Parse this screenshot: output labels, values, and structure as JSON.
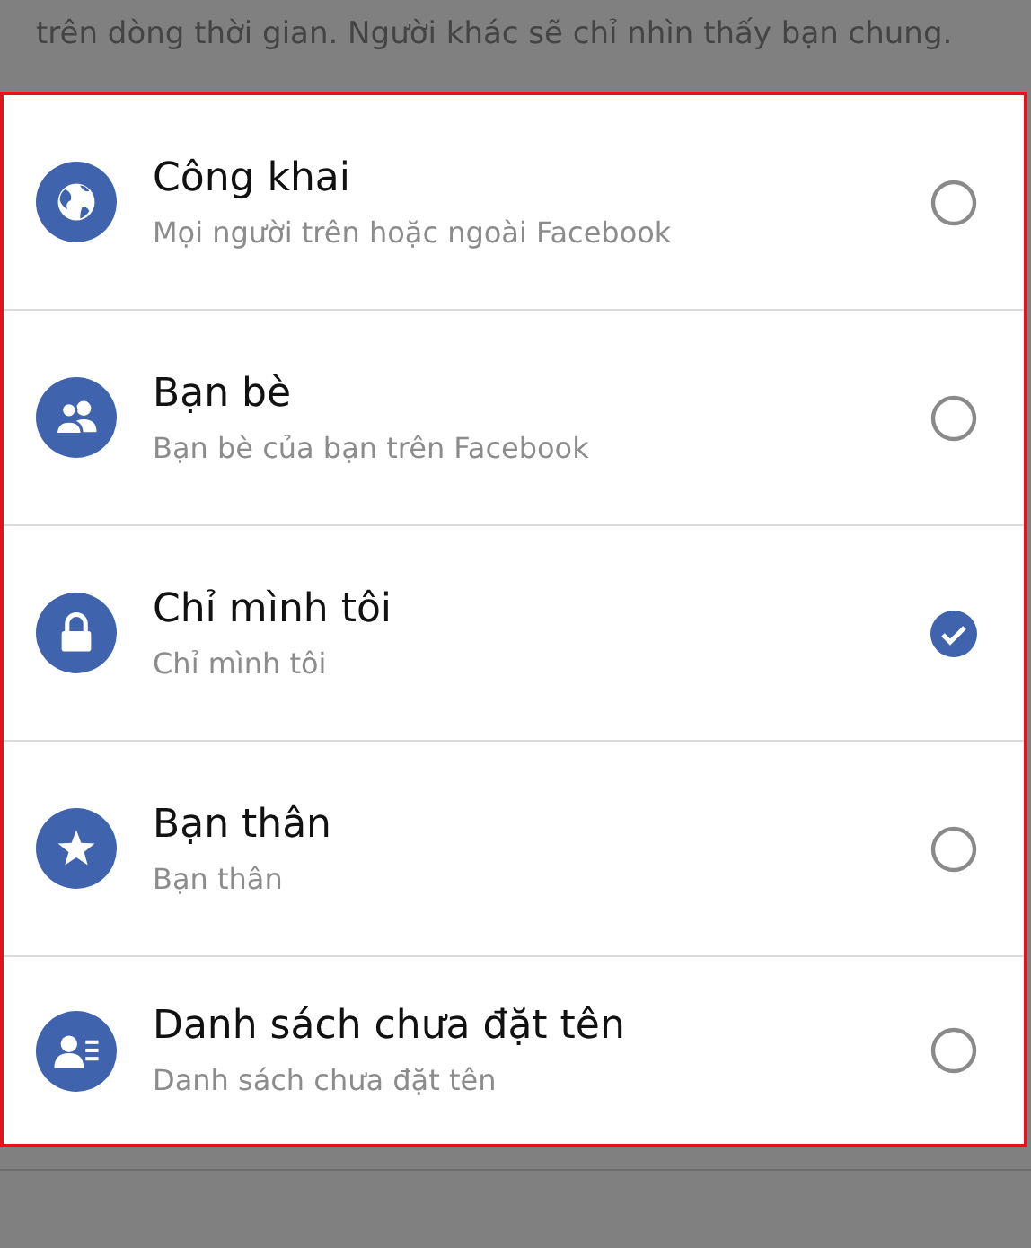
{
  "intro_text": "trên dòng thời gian. Người khác sẽ chỉ nhìn thấy bạn chung.",
  "options": [
    {
      "kind": "globe",
      "title": "Công khai",
      "subtitle": "Mọi người trên hoặc ngoài Facebook",
      "selected": false
    },
    {
      "kind": "friends",
      "title": "Bạn bè",
      "subtitle": "Bạn bè của bạn trên Facebook",
      "selected": false
    },
    {
      "kind": "lock",
      "title": "Chỉ mình tôi",
      "subtitle": "Chỉ mình tôi",
      "selected": true
    },
    {
      "kind": "star",
      "title": "Bạn thân",
      "subtitle": "Bạn thân",
      "selected": false
    },
    {
      "kind": "list",
      "title": "Danh sách chưa đặt tên",
      "subtitle": "Danh sách chưa đặt tên",
      "selected": false
    }
  ]
}
